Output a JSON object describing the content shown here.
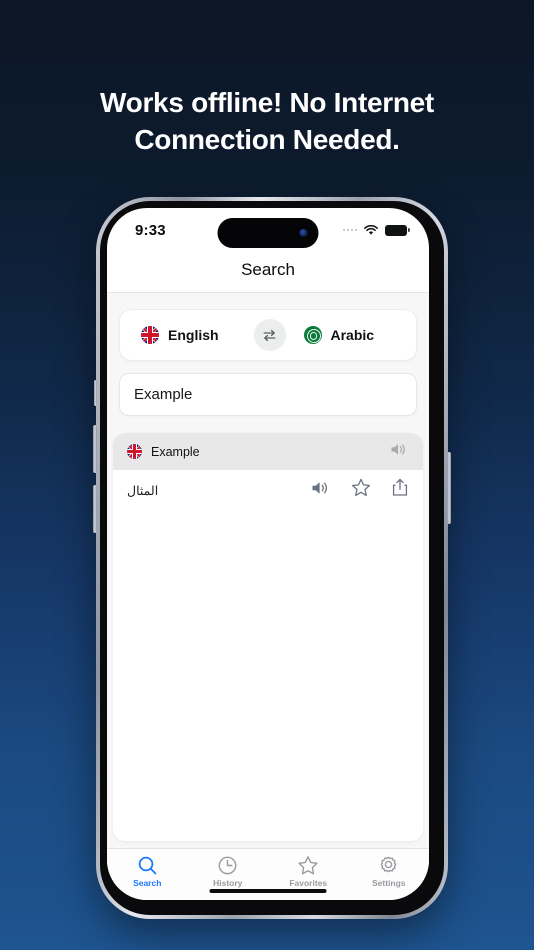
{
  "headline": {
    "line1": "Works offline! No Internet",
    "line2": "Connection Needed."
  },
  "colors": {
    "bg_top": "#0c1726",
    "bg_bottom": "#1e5490",
    "accent_blue": "#1a7aff",
    "row_highlight": "#e8e8e9",
    "icon_gray": "#6b7280",
    "flag_uk_blue": "#00247d",
    "flag_uk_red": "#cf142b",
    "flag_arabic_green": "#0d7a3d"
  },
  "status_bar": {
    "time": "9:33",
    "signal_icon": "signal-dots-icon",
    "wifi_icon": "wifi-icon",
    "battery_icon": "battery-icon"
  },
  "nav": {
    "title": "Search"
  },
  "language_selector": {
    "source": {
      "label": "English",
      "flag_icon": "flag-uk-icon"
    },
    "target": {
      "label": "Arabic",
      "flag_icon": "flag-arabic-icon"
    },
    "swap_icon": "swap-arrows-icon"
  },
  "search": {
    "value": "Example",
    "placeholder": "Example"
  },
  "results": [
    {
      "term": "Example",
      "term_flag_icon": "flag-uk-icon",
      "term_speaker_icon": "speaker-icon",
      "translation": "المثال",
      "actions": [
        {
          "name": "speaker-icon"
        },
        {
          "name": "star-icon"
        },
        {
          "name": "share-icon"
        }
      ]
    }
  ],
  "tabbar": {
    "items": [
      {
        "label": "Search",
        "icon": "magnifier-icon",
        "active": true
      },
      {
        "label": "History",
        "icon": "clock-icon",
        "active": false
      },
      {
        "label": "Favorites",
        "icon": "star-icon",
        "active": false
      },
      {
        "label": "Settings",
        "icon": "gear-icon",
        "active": false
      }
    ]
  }
}
